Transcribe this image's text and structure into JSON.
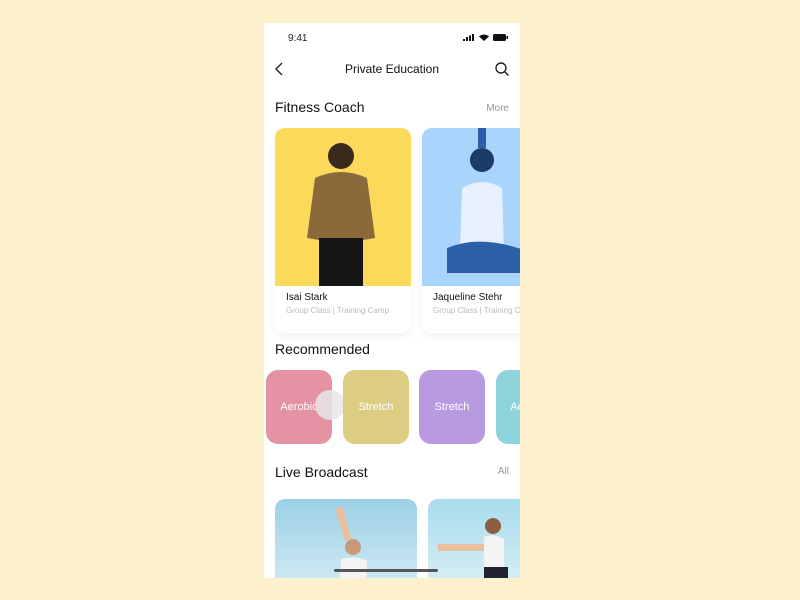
{
  "status": {
    "time": "9:41"
  },
  "nav": {
    "title": "Private Education"
  },
  "fitness": {
    "title": "Fitness Coach",
    "more": "More",
    "coaches": [
      {
        "name": "Isai Stark",
        "sub": "Group Class | Training Camp",
        "color": "#fcd95a"
      },
      {
        "name": "Jaqueline Stehr",
        "sub": "Group Class | Training Camp",
        "color": "#a9d4fb"
      }
    ]
  },
  "recommended": {
    "title": "Recommended",
    "items": [
      {
        "label": "Aerobic",
        "color": "#e592a2"
      },
      {
        "label": "Stretch",
        "color": "#dccd82"
      },
      {
        "label": "Stretch",
        "color": "#b89ae0"
      },
      {
        "label": "Aerobic",
        "color": "#8fd4dc"
      }
    ]
  },
  "live": {
    "title": "Live Broadcast",
    "all": "All"
  }
}
